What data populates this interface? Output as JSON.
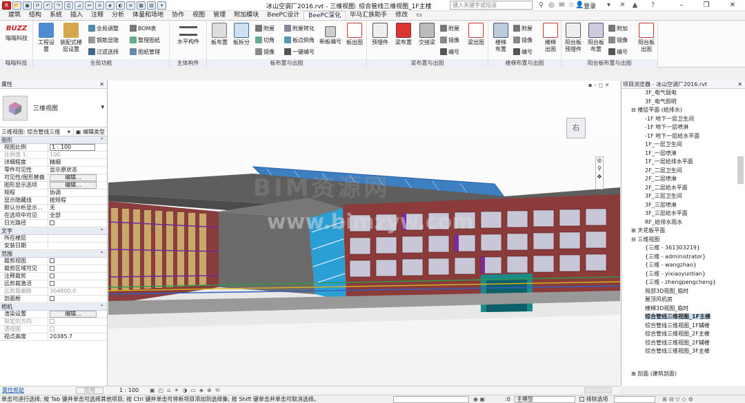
{
  "window_title": "冰山空调厂2016.rvt - 三维视图: 综合管线三维视图_1F主楼",
  "search_placeholder": "键入关键字或短语",
  "user_label": "登录",
  "tabs": [
    "建筑",
    "结构",
    "系统",
    "插入",
    "注释",
    "分析",
    "体量和场地",
    "协作",
    "视图",
    "管理",
    "附加模块",
    "BeePC设计",
    "BeePC深化",
    "毕马汇族助手",
    "修改"
  ],
  "active_tab": "BeePC深化",
  "ribbon": {
    "panel_titles": {
      "buzz": "嗡嗡科技",
      "global": "全局功能",
      "main_component": "主体构件",
      "slab": "板布置与出图",
      "beam": "梁布置与出图",
      "stair": "楼梯布置与出图",
      "balcony": "阳台板布置与出图"
    },
    "buzz_logo": "BUZZ",
    "buzz_label": "嗡嗡科技",
    "global_big": [
      "工程设置",
      "装配式楼层设置"
    ],
    "global_small": [
      "全局调整",
      "钢筋显隐",
      "过滤选择",
      "BOM表",
      "整理图纸",
      "图纸管理"
    ],
    "main_big": "水平构件",
    "slab_big": [
      "板布置",
      "板拆分"
    ],
    "slab_small": [
      "附屋",
      "切角",
      "镜像",
      "附屋转化",
      "板边倒角",
      "一键编号"
    ],
    "slab_big2": [
      "新板编号",
      "板出图"
    ],
    "beam_big": [
      "预埋件",
      "梁布置",
      "交接梁"
    ],
    "beam_small": [
      "附屋",
      "镜像",
      "编号"
    ],
    "beam_big2": "梁出图",
    "stair_big": [
      "楼梯布置",
      "楼梯出图"
    ],
    "stair_small": [
      "附屋",
      "镜像",
      "编号"
    ],
    "balcony_big": [
      "阳台板预埋件",
      "阳台板布置"
    ],
    "balcony_small": [
      "附加",
      "镜像",
      "编号"
    ],
    "balcony_big2": "阳台板出图"
  },
  "properties": {
    "header": "属性",
    "type_name": "三维视图",
    "selector": "三维视图: 综合管线三维",
    "edit_type": "编辑类型",
    "groups": [
      {
        "name": "图形",
        "rows": [
          [
            "视图比例",
            "1 : 100",
            "input"
          ],
          [
            "比例值 1:",
            "100",
            "gray"
          ],
          [
            "详细程度",
            "精细",
            ""
          ],
          [
            "零件可见性",
            "显示原状态",
            ""
          ],
          [
            "可见性/图形替换",
            "编辑...",
            "btn"
          ],
          [
            "图形显示选项",
            "编辑...",
            "btn"
          ],
          [
            "规程",
            "协调",
            ""
          ],
          [
            "显示隐藏线",
            "按规程",
            ""
          ],
          [
            "默认分析显示...",
            "无",
            ""
          ],
          [
            "在选项中可见",
            "全部",
            ""
          ],
          [
            "日光路径",
            "",
            "cb"
          ]
        ]
      },
      {
        "name": "文字",
        "rows": [
          [
            "所在楼层",
            "",
            ""
          ],
          [
            "安装日期",
            "",
            ""
          ]
        ]
      },
      {
        "name": "范围",
        "rows": [
          [
            "裁剪视图",
            "",
            "cb"
          ],
          [
            "裁剪区域可见",
            "",
            "cb"
          ],
          [
            "注释裁剪",
            "",
            "cb"
          ],
          [
            "远剪裁激活",
            "",
            "cb"
          ],
          [
            "远剪裁偏移",
            "304800.0",
            "gray"
          ],
          [
            "剖面框",
            "",
            "cb"
          ]
        ]
      },
      {
        "name": "相机",
        "rows": [
          [
            "渲染设置",
            "编辑...",
            "btn"
          ],
          [
            "锁定的方向",
            "",
            "cbgray"
          ],
          [
            "透视图",
            "",
            "cbgray"
          ],
          [
            "视点高度",
            "20385.7",
            ""
          ]
        ]
      }
    ],
    "help_link": "属性帮助",
    "apply": "应用"
  },
  "browser": {
    "header": "项目浏览器 - 冰山空调厂2016.rvt",
    "items": [
      [
        "3F_电气弱电",
        3,
        false
      ],
      [
        "3F_电气照明",
        3,
        false
      ],
      [
        "楼层平面 (给排水)",
        1,
        true
      ],
      [
        "-1F 地下一层卫生间",
        3,
        false
      ],
      [
        "-1F 地下一层喷淋",
        3,
        false
      ],
      [
        "-1F 地下一层给水平面",
        3,
        false
      ],
      [
        "1F_一层卫生间",
        3,
        false
      ],
      [
        "1F_一层喷淋",
        3,
        false
      ],
      [
        "1F_一层给排水平面",
        3,
        false
      ],
      [
        "2F_二层卫生间",
        3,
        false
      ],
      [
        "2F_二层喷淋",
        3,
        false
      ],
      [
        "2F_二层给水平面",
        3,
        false
      ],
      [
        "3F_三层卫生间",
        3,
        false
      ],
      [
        "3F_三层喷淋",
        3,
        false
      ],
      [
        "3F_三层给水平面",
        3,
        false
      ],
      [
        "RF_给排水雨水",
        3,
        false
      ],
      [
        "天花板平面",
        1,
        false
      ],
      [
        "三维视图",
        1,
        true
      ],
      [
        "{三维 - 361303219}",
        3,
        false
      ],
      [
        "{三维 - administrator}",
        3,
        false
      ],
      [
        "{三维 - wangzhao}",
        3,
        false
      ],
      [
        "{三维 - yixiaoyuntian}",
        3,
        false
      ],
      [
        "{三维 - zhengpengcheng}",
        3,
        false
      ],
      [
        "局部3D视图_临时",
        3,
        false
      ],
      [
        "屋顶风机房",
        3,
        false
      ],
      [
        "楼梯3D视图_临时",
        3,
        false
      ],
      [
        "综合管线三维视图_1F主楼",
        3,
        false
      ],
      [
        "综合管线三维视图_1F辅楼",
        3,
        false
      ],
      [
        "综合管线三维视图_2F主楼",
        3,
        false
      ],
      [
        "综合管线三维视图_2F辅楼",
        3,
        false
      ],
      [
        "综合管线三维视图_3F主楼",
        3,
        false
      ]
    ],
    "selected": "综合管线三维视图_1F主楼",
    "bottom_item": "剖面 (建筑剖面)"
  },
  "viewcube_label": "右",
  "watermark": "BIM资源网",
  "watermark_url": "www.bimzyw.com",
  "view_scale": "1 : 100",
  "status_text": "单击可进行选择; 按 Tab 键并单击可选择其他项目; 按 Ctrl 键并单击可将新项目添加到选择集; 按 Shift 键单击并单击可取消选择。",
  "status_model": "主模型",
  "exclude_options": "排除选项",
  "status_zero": ":0",
  "colors": {
    "accent": "#2b579a",
    "steel": "#2a9fd6",
    "roof": "#5a5a5a",
    "brick": "#8a3a3a"
  }
}
